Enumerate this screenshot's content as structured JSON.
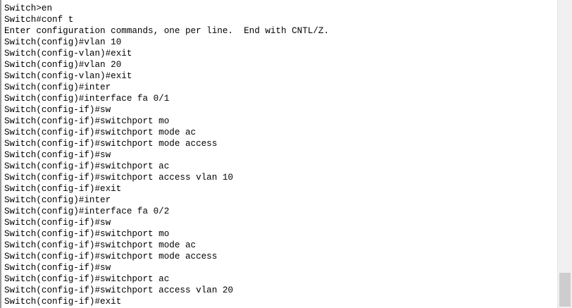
{
  "terminal": {
    "lines": [
      "Switch>en",
      "Switch#conf t",
      "Enter configuration commands, one per line.  End with CNTL/Z.",
      "Switch(config)#vlan 10",
      "Switch(config-vlan)#exit",
      "Switch(config)#vlan 20",
      "Switch(config-vlan)#exit",
      "Switch(config)#inter",
      "Switch(config)#interface fa 0/1",
      "Switch(config-if)#sw",
      "Switch(config-if)#switchport mo",
      "Switch(config-if)#switchport mode ac",
      "Switch(config-if)#switchport mode access",
      "Switch(config-if)#sw",
      "Switch(config-if)#switchport ac",
      "Switch(config-if)#switchport access vlan 10",
      "Switch(config-if)#exit",
      "Switch(config)#inter",
      "Switch(config)#interface fa 0/2",
      "Switch(config-if)#sw",
      "Switch(config-if)#switchport mo",
      "Switch(config-if)#switchport mode ac",
      "Switch(config-if)#switchport mode access",
      "Switch(config-if)#sw",
      "Switch(config-if)#switchport ac",
      "Switch(config-if)#switchport access vlan 20",
      "Switch(config-if)#exit"
    ]
  },
  "scrollbar": {
    "position": "bottom"
  },
  "colors": {
    "background": "#ffffff",
    "text": "#000000",
    "scrollbar_track": "#f0f0f0",
    "scrollbar_thumb": "#cdcdcd"
  }
}
